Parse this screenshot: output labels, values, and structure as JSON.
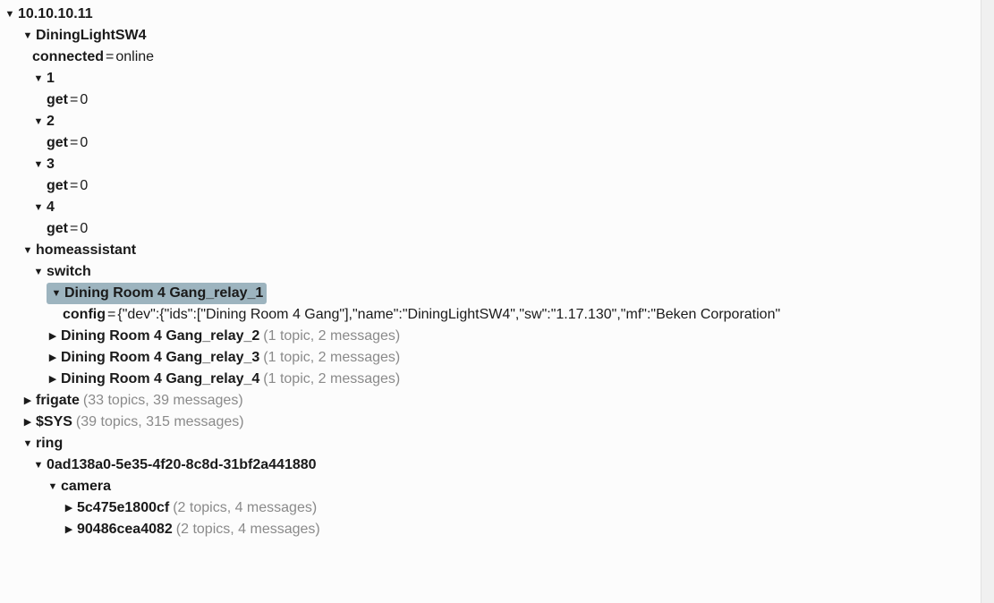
{
  "tree": {
    "root": "10.10.10.11",
    "dining": {
      "label": "DiningLightSW4",
      "connected_key": "connected",
      "connected_val": "online",
      "ch1": {
        "label": "1",
        "get_key": "get",
        "get_val": "0"
      },
      "ch2": {
        "label": "2",
        "get_key": "get",
        "get_val": "0"
      },
      "ch3": {
        "label": "3",
        "get_key": "get",
        "get_val": "0"
      },
      "ch4": {
        "label": "4",
        "get_key": "get",
        "get_val": "0"
      }
    },
    "ha": {
      "label": "homeassistant",
      "switch": {
        "label": "switch",
        "relay1": {
          "label": "Dining Room 4 Gang_relay_1",
          "config_key": "config",
          "config_val": "{\"dev\":{\"ids\":[\"Dining Room 4 Gang\"],\"name\":\"DiningLightSW4\",\"sw\":\"1.17.130\",\"mf\":\"Beken Corporation\""
        },
        "relay2": {
          "label": "Dining Room 4 Gang_relay_2",
          "meta": "(1 topic, 2 messages)"
        },
        "relay3": {
          "label": "Dining Room 4 Gang_relay_3",
          "meta": "(1 topic, 2 messages)"
        },
        "relay4": {
          "label": "Dining Room 4 Gang_relay_4",
          "meta": "(1 topic, 2 messages)"
        }
      }
    },
    "frigate": {
      "label": "frigate",
      "meta": "(33 topics, 39 messages)"
    },
    "sys": {
      "label": "$SYS",
      "meta": "(39 topics, 315 messages)"
    },
    "ring": {
      "label": "ring",
      "uuid": {
        "label": "0ad138a0-5e35-4f20-8c8d-31bf2a441880",
        "camera": {
          "label": "camera",
          "cam1": {
            "label": "5c475e1800cf",
            "meta": "(2 topics, 4 messages)"
          },
          "cam2": {
            "label": "90486cea4082",
            "meta": "(2 topics, 4 messages)"
          }
        }
      }
    }
  }
}
